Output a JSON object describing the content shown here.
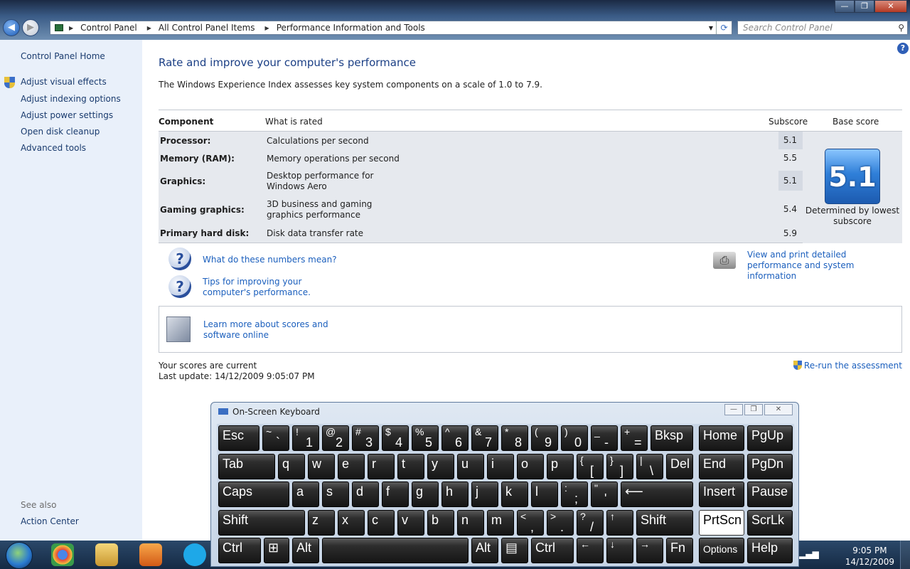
{
  "window": {
    "minimize": "—",
    "maximize": "❐",
    "close": "✕"
  },
  "address": {
    "segments": [
      "Control Panel",
      "All Control Panel Items",
      "Performance Information and Tools"
    ],
    "search_placeholder": "Search Control Panel"
  },
  "sidebar": {
    "home": "Control Panel Home",
    "items": [
      "Adjust visual effects",
      "Adjust indexing options",
      "Adjust power settings",
      "Open disk cleanup",
      "Advanced tools"
    ],
    "see_also_label": "See also",
    "see_also_items": [
      "Action Center"
    ]
  },
  "main": {
    "title": "Rate and improve your computer's performance",
    "intro": "The Windows Experience Index assesses key system components on a scale of 1.0 to 7.9.",
    "table": {
      "headers": {
        "component": "Component",
        "what": "What is rated",
        "subscore": "Subscore",
        "base": "Base score"
      },
      "rows": [
        {
          "component": "Processor:",
          "what": "Calculations per second",
          "subscore": "5.1"
        },
        {
          "component": "Memory (RAM):",
          "what": "Memory operations per second",
          "subscore": "5.5"
        },
        {
          "component": "Graphics:",
          "what": "Desktop performance for Windows Aero",
          "subscore": "5.1"
        },
        {
          "component": "Gaming graphics:",
          "what": "3D business and gaming graphics performance",
          "subscore": "5.4"
        },
        {
          "component": "Primary hard disk:",
          "what": "Disk data transfer rate",
          "subscore": "5.9"
        }
      ],
      "base_score": "5.1",
      "base_caption": "Determined by lowest subscore"
    },
    "links": {
      "numbers_mean": "What do these numbers mean?",
      "tips": "Tips for improving your computer's performance.",
      "print": "View and print detailed performance and system information",
      "learn_more": "Learn more about scores and software online"
    },
    "status": {
      "current": "Your scores are current",
      "last_update": "Last update: 14/12/2009 9:05:07 PM"
    },
    "rerun": "Re-run the assessment"
  },
  "osk": {
    "title": "On-Screen Keyboard",
    "keys": {
      "esc": "Esc",
      "bksp": "Bksp",
      "home": "Home",
      "pgup": "PgUp",
      "tab": "Tab",
      "del": "Del",
      "end": "End",
      "pgdn": "PgDn",
      "caps": "Caps",
      "insert": "Insert",
      "pause": "Pause",
      "shift": "Shift",
      "prtscn": "PrtScn",
      "scrlk": "ScrLk",
      "ctrl": "Ctrl",
      "alt": "Alt",
      "fn": "Fn",
      "options": "Options",
      "help": "Help",
      "q": "q",
      "w": "w",
      "e": "e",
      "r": "r",
      "t": "t",
      "y": "y",
      "u": "u",
      "i": "i",
      "o": "o",
      "p": "p",
      "a": "a",
      "s": "s",
      "d": "d",
      "f": "f",
      "g": "g",
      "h": "h",
      "j": "j",
      "k": "k",
      "l": "l",
      "z": "z",
      "x": "x",
      "c": "c",
      "v": "v",
      "b": "b",
      "n": "n",
      "m": "m",
      "n1u": "!",
      "n1": "1",
      "n2u": "@",
      "n2": "2",
      "n3u": "#",
      "n3": "3",
      "n4u": "$",
      "n4": "4",
      "n5u": "%",
      "n5": "5",
      "n6u": "^",
      "n6": "6",
      "n7u": "&",
      "n7": "7",
      "n8u": "*",
      "n8": "8",
      "n9u": "(",
      "n9": "9",
      "n0u": ")",
      "n0": "0",
      "minu": "_",
      "min": "-",
      "equ": "+",
      "eq": "=",
      "tilu": "~",
      "til": "`",
      "lbu": "{",
      "lb": "[",
      "rbu": "}",
      "rb": "]",
      "bsu": "|",
      "bs": "\\",
      "scu": ":",
      "sc": ";",
      "quu": "\"",
      "qu": "'",
      "ltu": "<",
      "lt": ",",
      "gtu": ">",
      "gt": ".",
      "slu": "?",
      "sl": "/",
      "enter": "⟵",
      "up": "↑",
      "down": "↓",
      "left": "←",
      "right": "→",
      "menu": "▤",
      "win": "⊞"
    }
  },
  "tray": {
    "time": "9:05 PM",
    "date": "14/12/2009"
  }
}
